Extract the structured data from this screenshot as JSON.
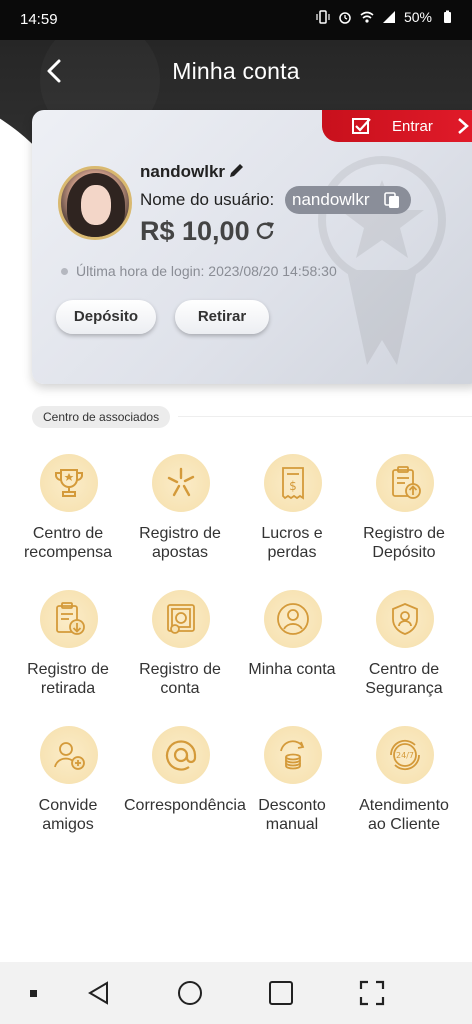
{
  "status_bar": {
    "time": "14:59",
    "battery": "50%"
  },
  "header": {
    "title": "Minha conta"
  },
  "card": {
    "enter_label": "Entrar",
    "username": "nandowlkr",
    "user_name_label": "Nome do usuário:",
    "user_name_value": "nandowlkr",
    "balance": "R$ 10,00",
    "last_login": "Última hora de login: 2023/08/20 14:58:30",
    "deposit_button": "Depósito",
    "withdraw_button": "Retirar"
  },
  "section": {
    "label": "Centro de associados"
  },
  "menu": [
    {
      "label": "Centro de recompensa",
      "icon": "trophy-icon"
    },
    {
      "label": "Registro de apostas",
      "icon": "sparkle-icon"
    },
    {
      "label": "Lucros e perdas",
      "icon": "receipt-dollar-icon"
    },
    {
      "label": "Registro de Depósito",
      "icon": "clipboard-upload-icon"
    },
    {
      "label": "Registro de retirada",
      "icon": "clipboard-download-icon"
    },
    {
      "label": "Registro de conta",
      "icon": "account-record-icon"
    },
    {
      "label": "Minha conta",
      "icon": "user-icon"
    },
    {
      "label": "Centro de Segurança",
      "icon": "shield-user-icon"
    },
    {
      "label": "Convide amigos",
      "icon": "invite-user-icon"
    },
    {
      "label": "Correspondência",
      "icon": "at-icon"
    },
    {
      "label": "Desconto manual",
      "icon": "coins-icon"
    },
    {
      "label": "Atendimento ao Cliente",
      "icon": "support-24-7-icon"
    }
  ],
  "colors": {
    "accent_red": "#e21b2a",
    "gold": "#d9a441",
    "icon_bg": "#f7e3b4",
    "header_bg": "#2a2a2a"
  }
}
